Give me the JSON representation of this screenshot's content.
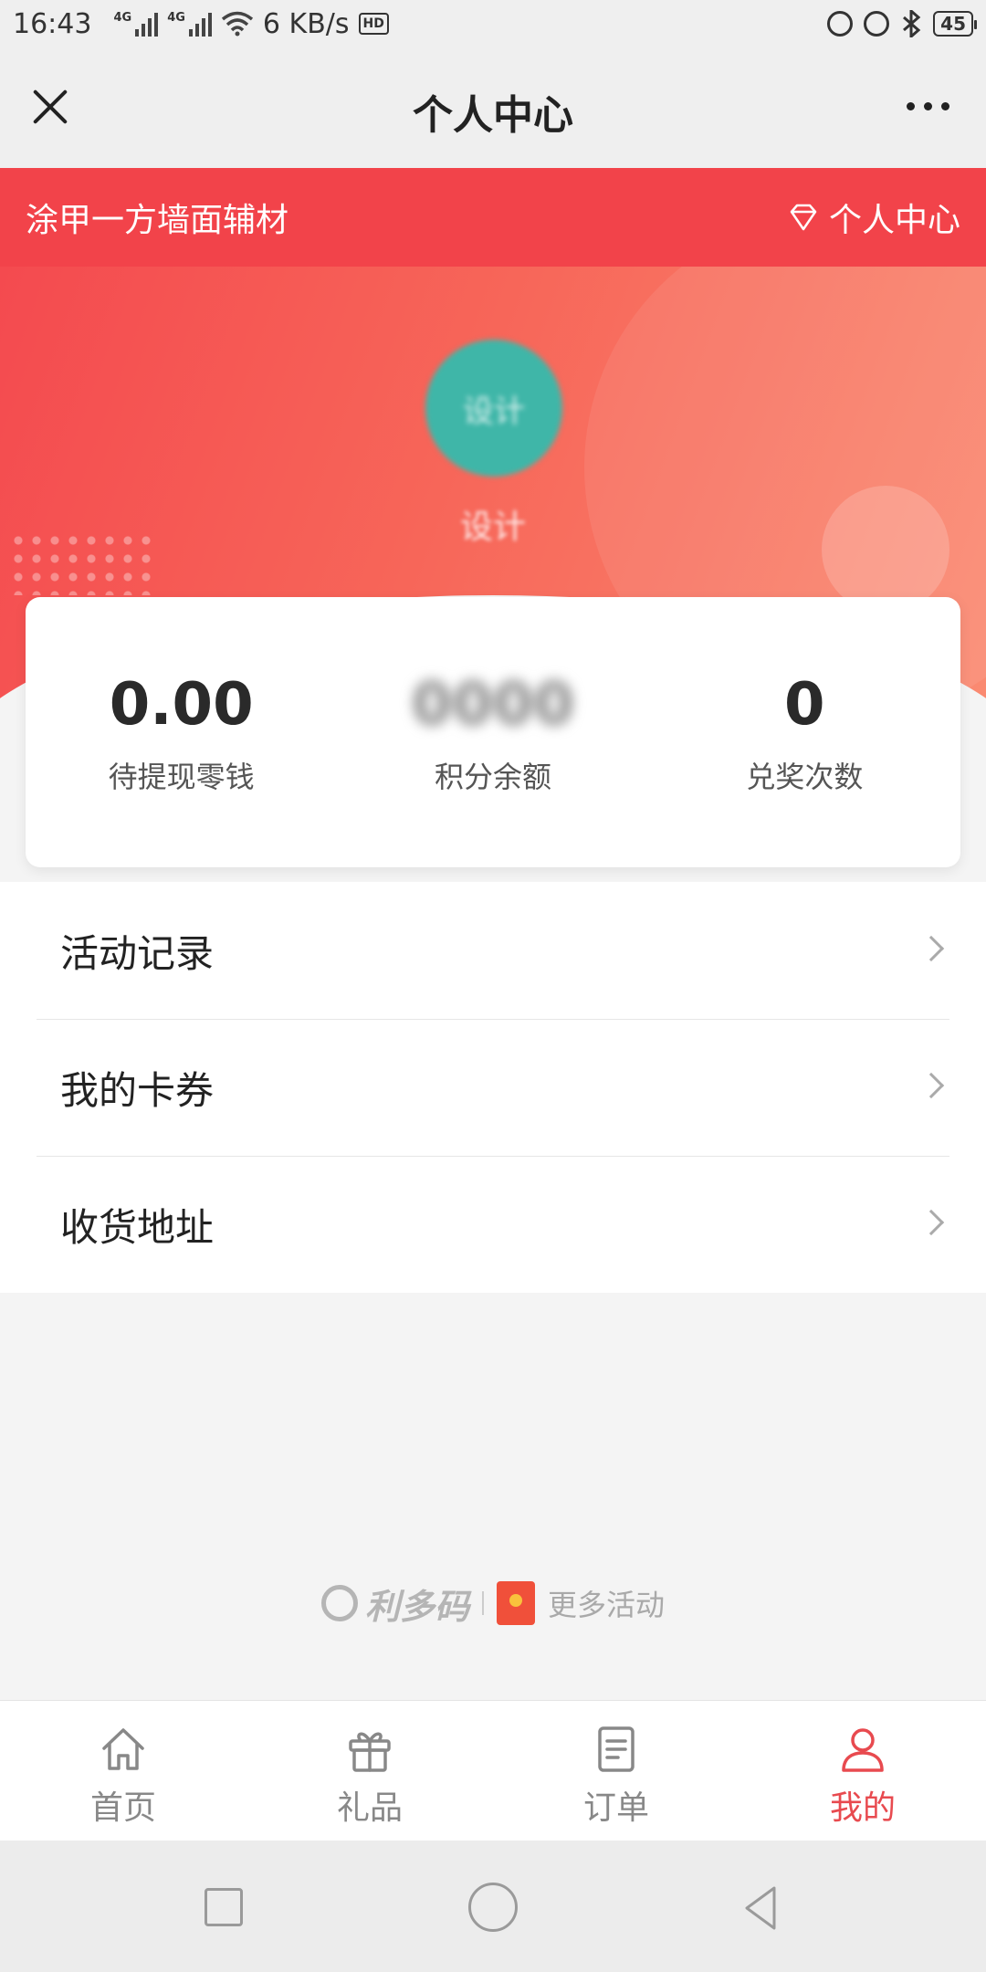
{
  "status_bar": {
    "time": "16:43",
    "network_speed": "6 KB/s",
    "net_type_1": "4G",
    "net_type_2": "4G",
    "hd": "HD",
    "battery": "45"
  },
  "title_bar": {
    "title": "个人中心",
    "close_icon": "close-icon",
    "more_icon": "more-icon"
  },
  "brand_bar": {
    "store_name": "涂甲一方墙面辅材",
    "right_label": "个人中心",
    "right_icon": "diamond-icon"
  },
  "profile": {
    "avatar_text": "设计",
    "nickname": "设计"
  },
  "stats": [
    {
      "value": "0.00",
      "label": "待提现零钱",
      "blurred": false
    },
    {
      "value": "0000",
      "label": "积分余额",
      "blurred": true
    },
    {
      "value": "0",
      "label": "兑奖次数",
      "blurred": false
    }
  ],
  "menu": [
    {
      "label": "活动记录"
    },
    {
      "label": "我的卡券"
    },
    {
      "label": "收货地址"
    }
  ],
  "promo": {
    "brand": "利多码",
    "more_label": "更多活动"
  },
  "tabs": [
    {
      "label": "首页",
      "icon": "home-icon",
      "active": false
    },
    {
      "label": "礼品",
      "icon": "gift-icon",
      "active": false
    },
    {
      "label": "订单",
      "icon": "order-icon",
      "active": false
    },
    {
      "label": "我的",
      "icon": "user-icon",
      "active": true
    }
  ],
  "colors": {
    "brand_red": "#f2434a",
    "active_tab": "#e84a4f",
    "avatar_teal": "#3fb6a8"
  }
}
